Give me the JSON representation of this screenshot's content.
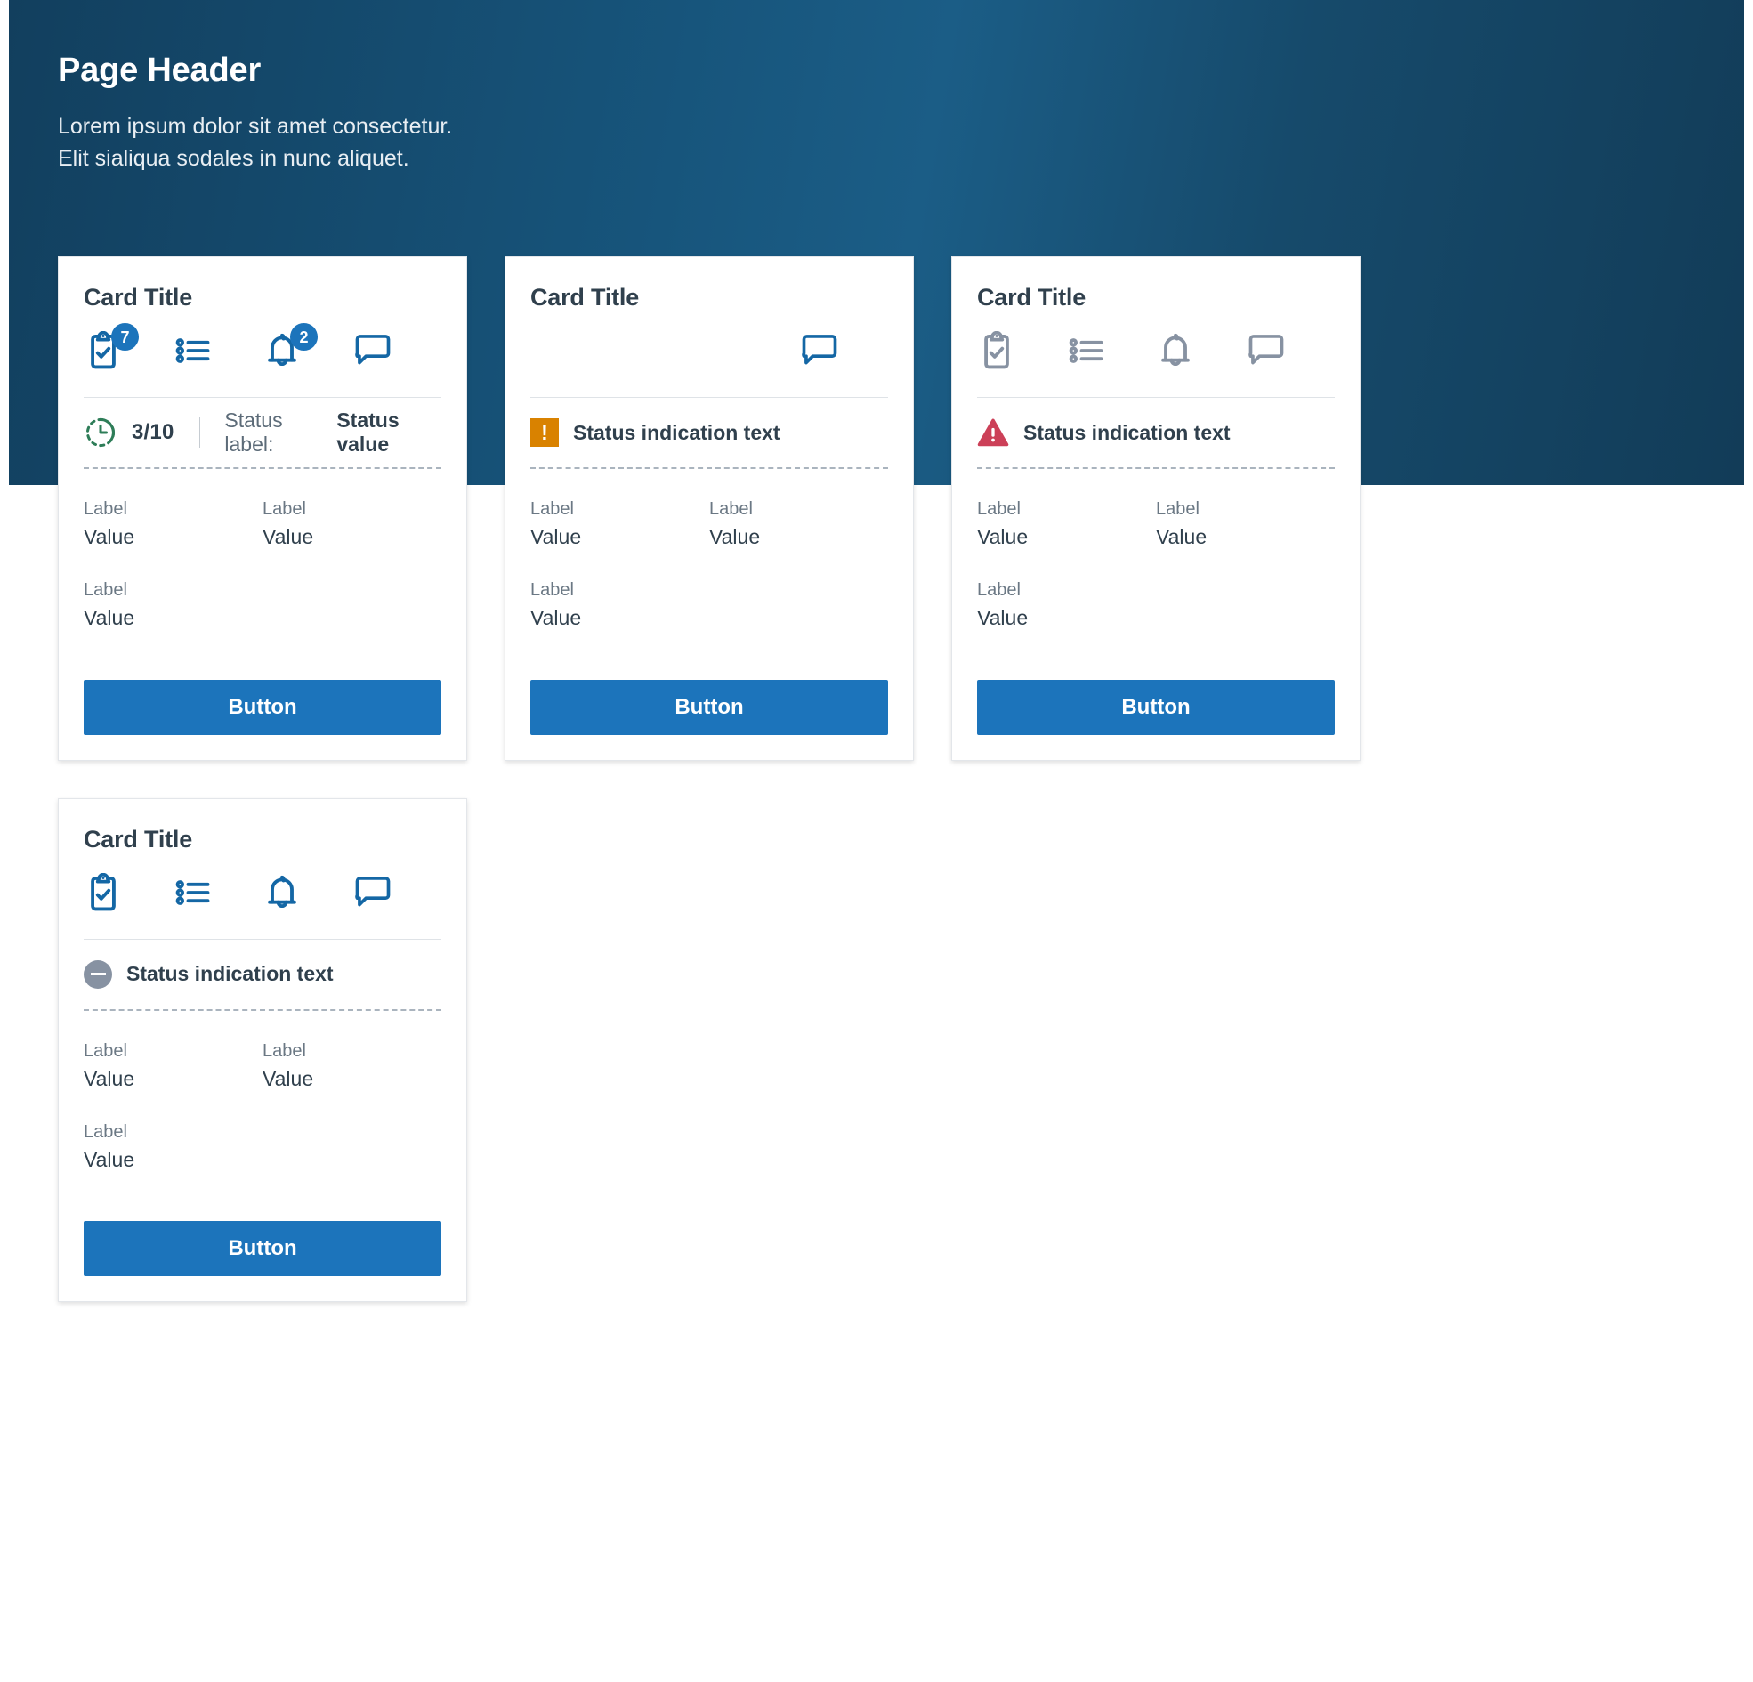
{
  "theme": {
    "header_gradient_from": "#123f5e",
    "header_gradient_to": "#1b5d86",
    "accent_blue": "#1c74bb",
    "icon_blue": "#1467a5",
    "icon_gray": "#8792a2",
    "warning_orange": "#d98200",
    "error_red": "#cc4058",
    "progress_green": "#2e7d58",
    "text_dark": "#30404d",
    "text_muted": "#6b7884"
  },
  "header": {
    "title": "Page Header",
    "subtitle_line1": "Lorem ipsum dolor sit amet consectetur.",
    "subtitle_line2": "Elit sialiqua sodales in nunc aliquet."
  },
  "cards": [
    {
      "title": "Card Title",
      "icons": [
        {
          "name": "clipboard-check-icon",
          "state": "active",
          "badge": "7"
        },
        {
          "name": "list-icon",
          "state": "active",
          "badge": null
        },
        {
          "name": "bell-icon",
          "state": "active",
          "badge": "2"
        },
        {
          "name": "comment-icon",
          "state": "active",
          "badge": null
        }
      ],
      "status": {
        "type": "progress",
        "icon": "clock-progress-icon",
        "count": "3/10",
        "label": "Status label:",
        "value": "Status value"
      },
      "fields": [
        {
          "label": "Label",
          "value": "Value"
        },
        {
          "label": "Label",
          "value": "Value"
        },
        {
          "label": "Label",
          "value": "Value"
        }
      ],
      "button_label": "Button"
    },
    {
      "title": "Card Title",
      "icons": [
        {
          "name": "clipboard-check-icon",
          "state": "hidden",
          "badge": null
        },
        {
          "name": "list-icon",
          "state": "hidden",
          "badge": null
        },
        {
          "name": "bell-icon",
          "state": "hidden",
          "badge": null
        },
        {
          "name": "comment-icon",
          "state": "active",
          "badge": null
        }
      ],
      "status": {
        "type": "warning",
        "icon": "warning-square-icon",
        "text": "Status indication text"
      },
      "fields": [
        {
          "label": "Label",
          "value": "Value"
        },
        {
          "label": "Label",
          "value": "Value"
        },
        {
          "label": "Label",
          "value": "Value"
        }
      ],
      "button_label": "Button"
    },
    {
      "title": "Card Title",
      "icons": [
        {
          "name": "clipboard-check-icon",
          "state": "disabled",
          "badge": null
        },
        {
          "name": "list-icon",
          "state": "disabled",
          "badge": null
        },
        {
          "name": "bell-icon",
          "state": "disabled",
          "badge": null
        },
        {
          "name": "comment-icon",
          "state": "disabled",
          "badge": null
        }
      ],
      "status": {
        "type": "error",
        "icon": "error-triangle-icon",
        "text": "Status indication text"
      },
      "fields": [
        {
          "label": "Label",
          "value": "Value"
        },
        {
          "label": "Label",
          "value": "Value"
        },
        {
          "label": "Label",
          "value": "Value"
        }
      ],
      "button_label": "Button"
    },
    {
      "title": "Card Title",
      "icons": [
        {
          "name": "clipboard-check-icon",
          "state": "active",
          "badge": null
        },
        {
          "name": "list-icon",
          "state": "active",
          "badge": null
        },
        {
          "name": "bell-icon",
          "state": "active",
          "badge": null
        },
        {
          "name": "comment-icon",
          "state": "active",
          "badge": null
        }
      ],
      "status": {
        "type": "neutral",
        "icon": "minus-circle-icon",
        "text": "Status indication text"
      },
      "fields": [
        {
          "label": "Label",
          "value": "Value"
        },
        {
          "label": "Label",
          "value": "Value"
        },
        {
          "label": "Label",
          "value": "Value"
        }
      ],
      "button_label": "Button"
    }
  ]
}
